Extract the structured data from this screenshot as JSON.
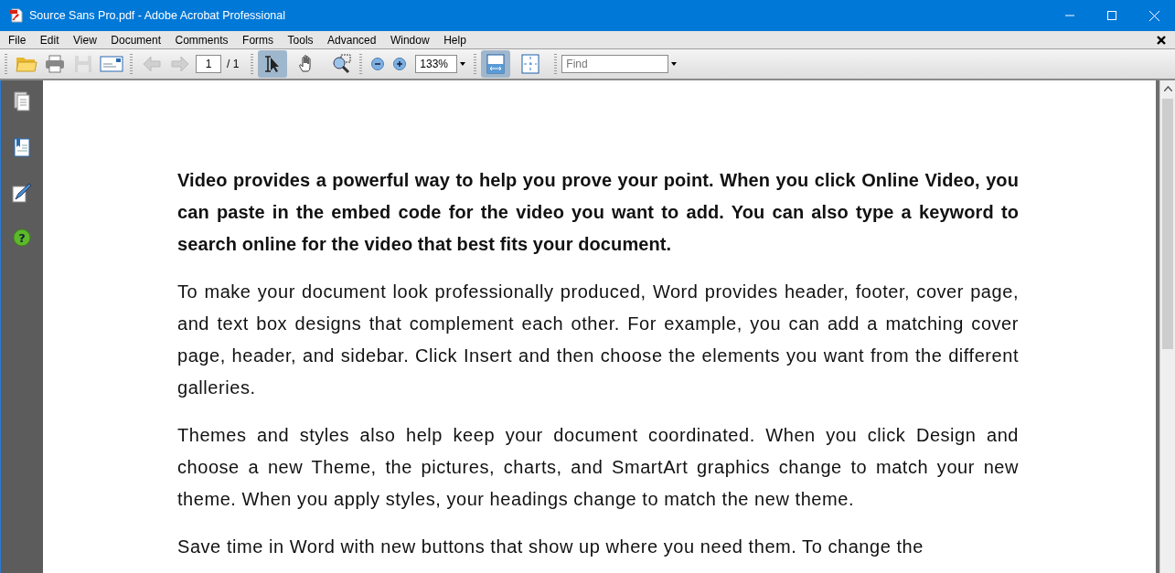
{
  "window": {
    "title": "Source Sans Pro.pdf - Adobe Acrobat Professional"
  },
  "menu": [
    "File",
    "Edit",
    "View",
    "Document",
    "Comments",
    "Forms",
    "Tools",
    "Advanced",
    "Window",
    "Help"
  ],
  "toolbar": {
    "page": "1",
    "page_total": "/ 1",
    "zoom": "133%",
    "find": {
      "placeholder": "Find"
    },
    "tools": [
      {
        "kind": "select",
        "selected": true
      },
      {
        "kind": "hand",
        "selected": false
      },
      {
        "kind": "zoom",
        "selected": false
      }
    ],
    "views": [
      {
        "kind": "fit-width",
        "selected": true
      },
      {
        "kind": "full-screen",
        "selected": false
      }
    ]
  },
  "sidebar": {
    "help_label": "?"
  },
  "document": {
    "paragraphs": [
      {
        "text": "Video provides a powerful way to help you prove your point. When you click Online Video, you can paste in the embed code for the video you want to add. You can also type a keyword to search online for the video that best fits your document.",
        "bold": true
      },
      {
        "text": "To make your document look professionally produced, Word provides header, footer, cover page, and text box designs that complement each other. For example, you can add a matching cover page, header, and sidebar. Click Insert and then choose the elements you want from the different galleries.",
        "bold": false
      },
      {
        "text": "Themes and styles also help keep your document coordinated. When you click Design and choose a new Theme, the pictures, charts, and SmartArt graphics change to match your new theme. When you apply styles, your headings change to match the new theme.",
        "bold": false
      },
      {
        "text": "Save time in Word with new buttons that show up where you need them. To change the",
        "bold": false
      }
    ]
  }
}
